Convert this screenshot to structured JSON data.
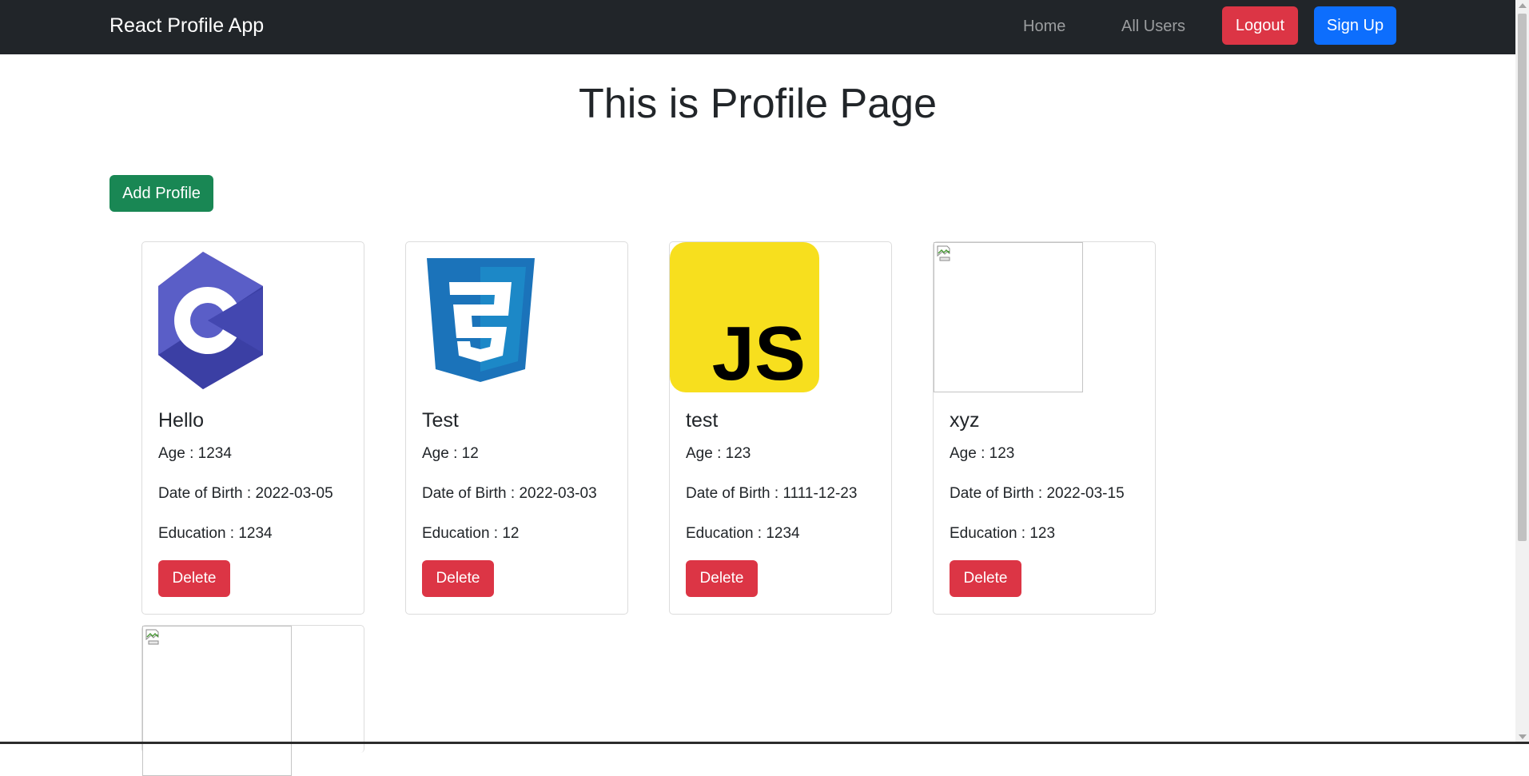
{
  "navbar": {
    "brand": "React Profile App",
    "links": [
      "Home",
      "All Users"
    ],
    "logout_label": "Logout",
    "signup_label": "Sign Up"
  },
  "page": {
    "title": "This is Profile Page",
    "add_button": "Add Profile"
  },
  "profiles": [
    {
      "name": "Hello",
      "age": "Age : 1234",
      "dob": "Date of Birth : 2022-03-05",
      "education": "Education : 1234",
      "delete_label": "Delete",
      "image_icon": "csharp-logo"
    },
    {
      "name": "Test",
      "age": "Age : 12",
      "dob": "Date of Birth : 2022-03-03",
      "education": "Education : 12",
      "delete_label": "Delete",
      "image_icon": "css3-logo"
    },
    {
      "name": "test",
      "age": "Age : 123",
      "dob": "Date of Birth : 1111-12-23",
      "education": "Education : 1234",
      "delete_label": "Delete",
      "image_icon": "javascript-logo",
      "image_text": "JS"
    },
    {
      "name": "xyz",
      "age": "Age : 123",
      "dob": "Date of Birth : 2022-03-15",
      "education": "Education : 123",
      "delete_label": "Delete",
      "image_icon": "broken-image-icon"
    }
  ],
  "colors": {
    "navbar_bg": "#212529",
    "logout": "#dc3545",
    "signup": "#0d6efd",
    "add_profile": "#198754",
    "delete": "#dc3545"
  }
}
